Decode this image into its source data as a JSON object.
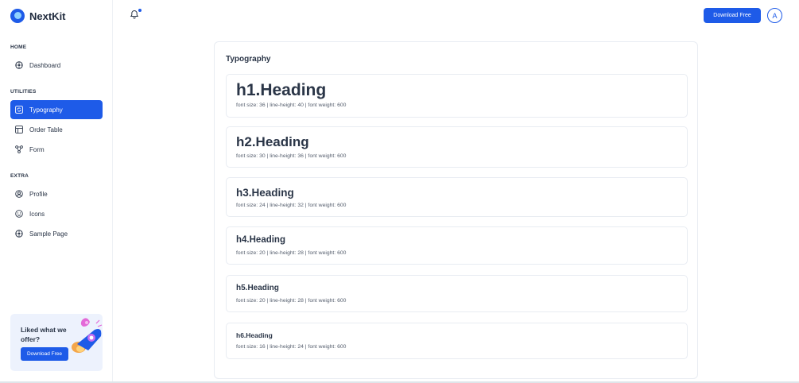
{
  "brand": {
    "name": "NextKit"
  },
  "sidebar": {
    "sections": [
      {
        "title": "HOME",
        "items": [
          {
            "label": "Dashboard",
            "icon": "dashboard-icon"
          }
        ]
      },
      {
        "title": "UTILITIES",
        "items": [
          {
            "label": "Typography",
            "icon": "typography-icon",
            "active": true
          },
          {
            "label": "Order Table",
            "icon": "table-icon"
          },
          {
            "label": "Form",
            "icon": "form-icon"
          }
        ]
      },
      {
        "title": "EXTRA",
        "items": [
          {
            "label": "Profile",
            "icon": "profile-icon"
          },
          {
            "label": "Icons",
            "icon": "smile-icon"
          },
          {
            "label": "Sample Page",
            "icon": "page-icon"
          }
        ]
      }
    ],
    "promo": {
      "text": "Liked what we offer?",
      "button": "Download Free"
    }
  },
  "header": {
    "download_label": "Download Free",
    "avatar_initial": "A",
    "bell_icon": "bell-icon"
  },
  "main": {
    "card_title": "Typography",
    "headings": [
      {
        "label": "h1.Heading",
        "meta": "font size: 36 | line-height: 40 | font weight: 600"
      },
      {
        "label": "h2.Heading",
        "meta": "font size: 30 | line-height: 36 | font weight: 600"
      },
      {
        "label": "h3.Heading",
        "meta": "font size: 24 | line-height: 32 | font weight: 600"
      },
      {
        "label": "h4.Heading",
        "meta": "font size: 20 | line-height: 28 | font weight: 600"
      },
      {
        "label": "h5.Heading",
        "meta": "font size: 20 | line-height: 28 | font weight: 600"
      },
      {
        "label": "h6.Heading",
        "meta": "font size: 16 | line-height: 24 | font weight: 600"
      }
    ]
  },
  "colors": {
    "primary": "#1e5be8",
    "text": "#2a3547",
    "promo_bg": "#edf2fd"
  }
}
